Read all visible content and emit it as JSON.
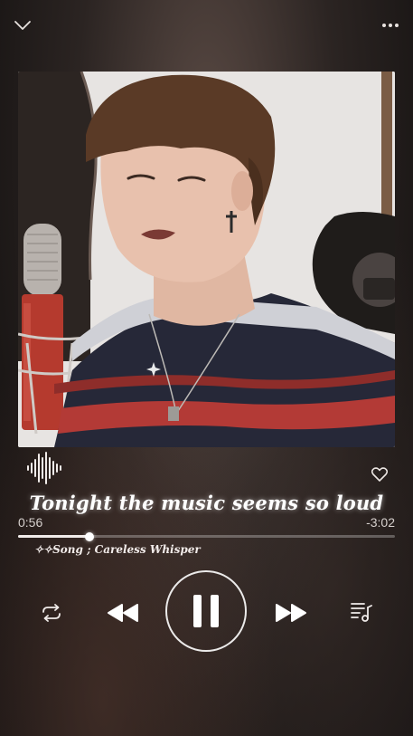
{
  "player": {
    "lyric_line": "Tonight the music seems so loud",
    "elapsed": "0:56",
    "remaining": "-3:02",
    "song_label": "✧✧Song ; Careless Whisper",
    "progress": 0.19
  },
  "icons": {
    "collapse": "chevron-down-icon",
    "menu": "more-icon",
    "wave": "waveform-icon",
    "like": "heart-icon",
    "repeat": "repeat-icon",
    "previous": "rewind-icon",
    "playpause": "pause-icon",
    "next": "fast-forward-icon",
    "queue": "queue-music-icon"
  },
  "colors": {
    "accent": "#ffffff",
    "background": "#2b2422"
  }
}
